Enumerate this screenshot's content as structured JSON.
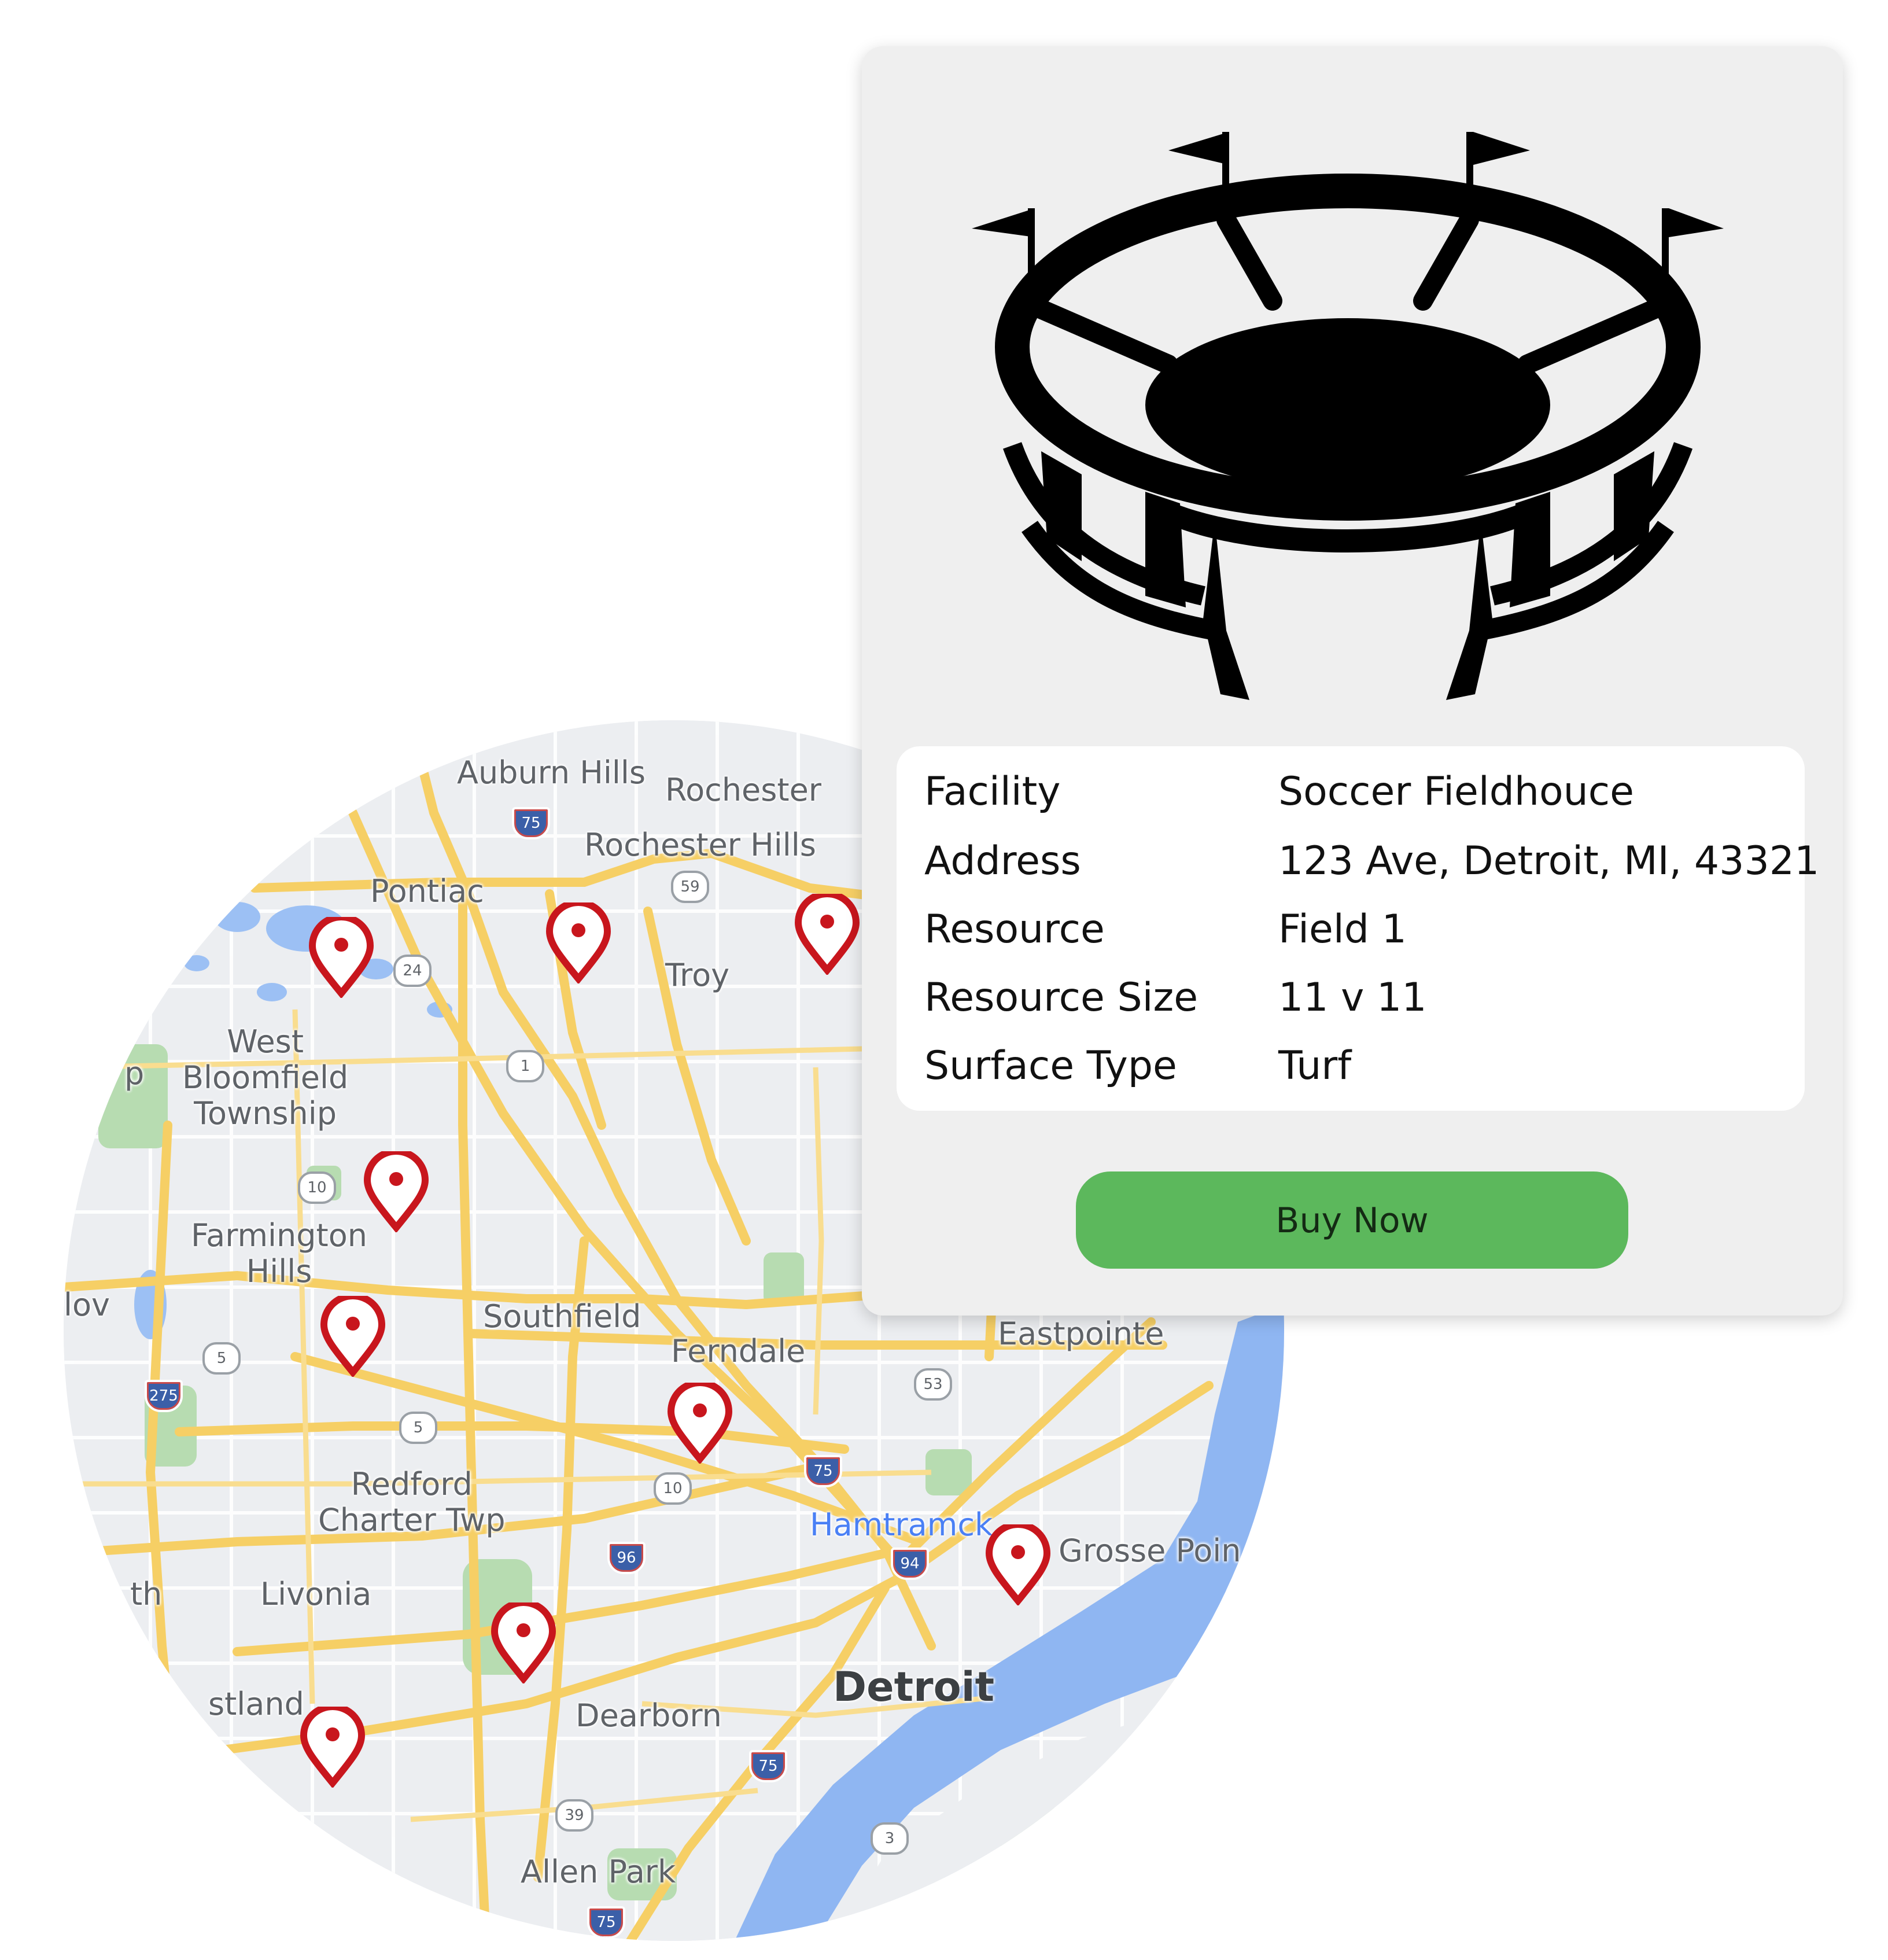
{
  "map": {
    "labels": {
      "auburn_hills": "Auburn Hills",
      "rochester": "Rochester",
      "rochester_hills": "Rochester Hills",
      "pontiac": "Pontiac",
      "troy": "Troy",
      "west_bloomfield": "West\nBloomfield\nTownship",
      "farmington_hills": "Farmington\nHills",
      "southfield": "Southfield",
      "ferndale": "Ferndale",
      "eastpointe": "Eastpointe",
      "redford": "Redford\nCharter Twp",
      "livonia": "Livonia",
      "hamtramck": "Hamtramck",
      "grosse_pointe": "Grosse Poin",
      "westland": "stland",
      "dearborn": "Dearborn",
      "detroit": "Detroit",
      "allen_park": "Allen Park",
      "novi": "lov",
      "edge_left": "p",
      "edge_left2": "th"
    },
    "shields": {
      "s75_top": "75",
      "s59": "59",
      "s24": "24",
      "s1": "1",
      "s10a": "10",
      "s5a": "5",
      "s5b": "5",
      "s275": "275",
      "s53": "53",
      "s75_mid": "75",
      "s10b": "10",
      "s96": "96",
      "s94": "94",
      "s75_low": "75",
      "s39": "39",
      "s3": "3",
      "s75_bottom": "75"
    },
    "pin_color": "#c8161d",
    "road_color": "#f6cf65",
    "water_color": "#8fb6f2",
    "park_color": "#a8d5a2"
  },
  "card": {
    "icon": "stadium-icon",
    "rows": [
      {
        "label": "Facility",
        "value": "Soccer Fieldhouce"
      },
      {
        "label": "Address",
        "value": "123 Ave, Detroit, MI, 43321"
      },
      {
        "label": "Resource",
        "value": "Field 1"
      },
      {
        "label": "Resource Size",
        "value": "11 v 11"
      },
      {
        "label": "Surface Type",
        "value": "Turf"
      }
    ],
    "buy_label": "Buy Now",
    "button_color": "#5cb85c"
  }
}
